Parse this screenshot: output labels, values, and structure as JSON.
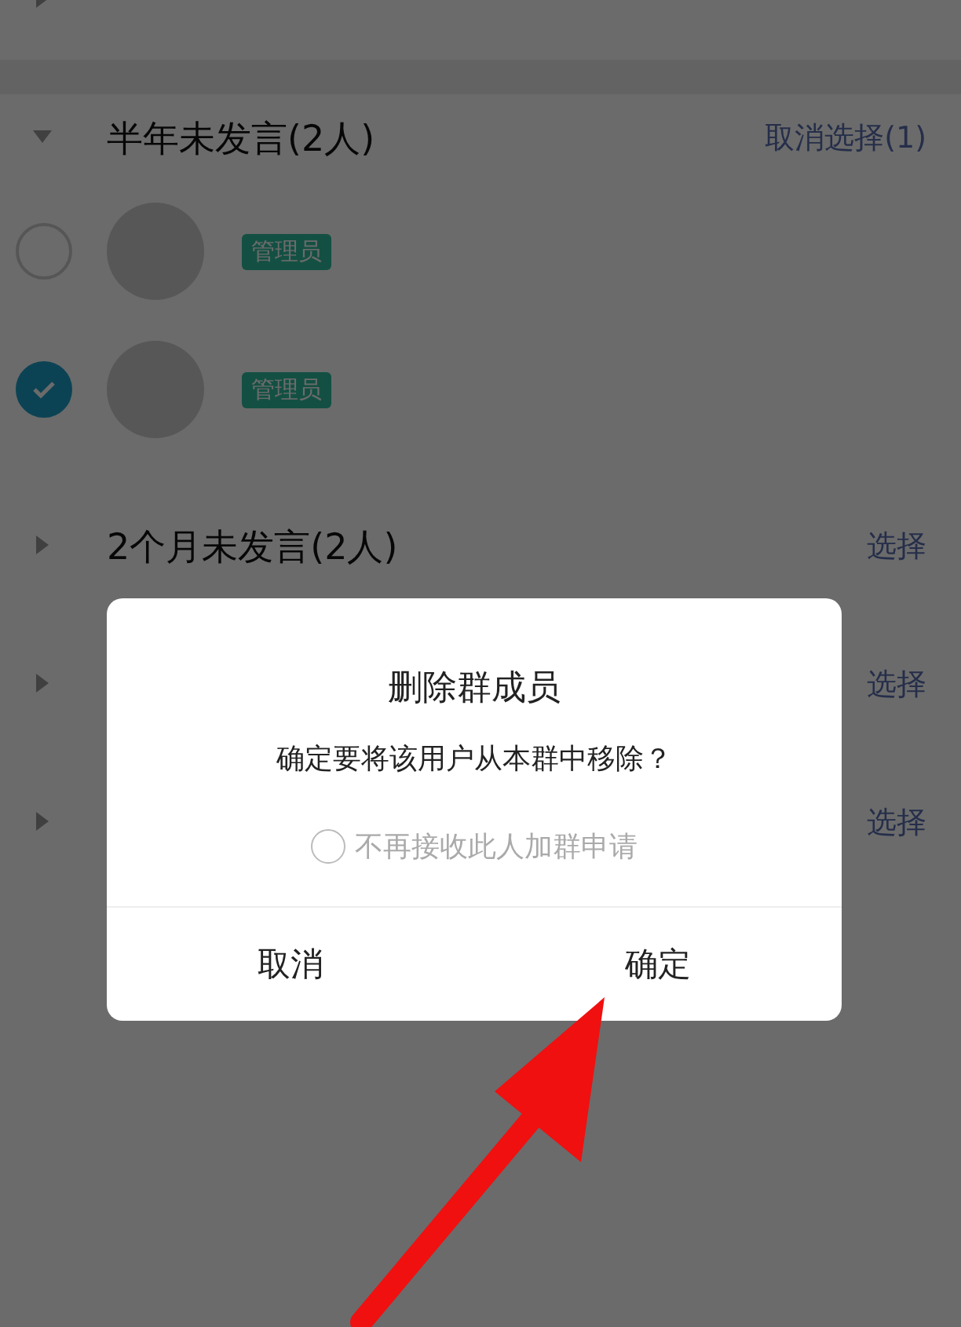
{
  "sections": [
    {
      "expanded": false
    },
    {
      "title": "半年未发言(2人)",
      "expanded": true,
      "action": "取消选择(1)",
      "members": [
        {
          "badge": "管理员",
          "selected": false
        },
        {
          "badge": "管理员",
          "selected": true
        }
      ]
    },
    {
      "title": "2个月未发言(2人)",
      "expanded": false,
      "action": "选择"
    },
    {
      "expanded": false,
      "action": "选择"
    },
    {
      "expanded": false,
      "action": "选择"
    }
  ],
  "dialog": {
    "title": "删除群成员",
    "message": "确定要将该用户从本群中移除？",
    "option": {
      "label": "不再接收此人加群申请",
      "checked": false
    },
    "buttons": [
      "取消",
      "确定"
    ]
  }
}
